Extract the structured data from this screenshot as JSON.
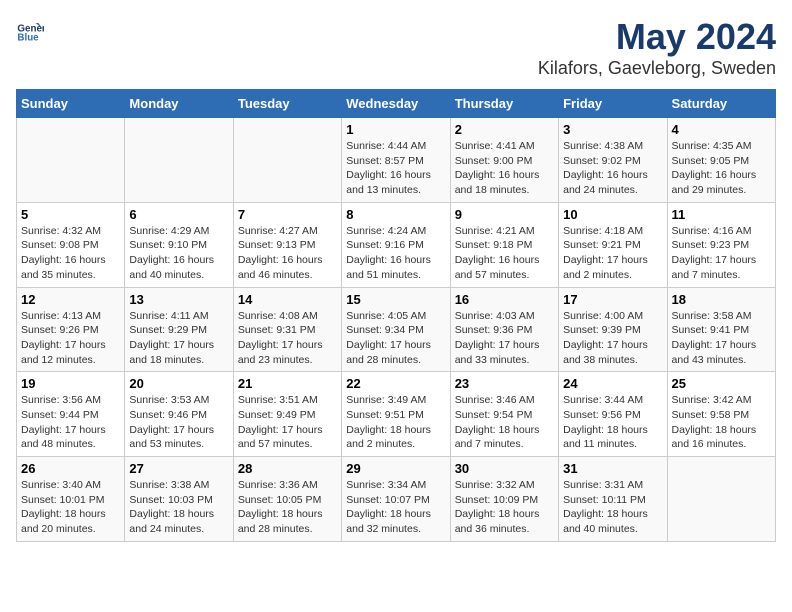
{
  "logo": {
    "text_general": "General",
    "text_blue": "Blue"
  },
  "title": "May 2024",
  "subtitle": "Kilafors, Gaevleborg, Sweden",
  "days_of_week": [
    "Sunday",
    "Monday",
    "Tuesday",
    "Wednesday",
    "Thursday",
    "Friday",
    "Saturday"
  ],
  "weeks": [
    [
      {
        "day": "",
        "info": ""
      },
      {
        "day": "",
        "info": ""
      },
      {
        "day": "",
        "info": ""
      },
      {
        "day": "1",
        "info": "Sunrise: 4:44 AM\nSunset: 8:57 PM\nDaylight: 16 hours\nand 13 minutes."
      },
      {
        "day": "2",
        "info": "Sunrise: 4:41 AM\nSunset: 9:00 PM\nDaylight: 16 hours\nand 18 minutes."
      },
      {
        "day": "3",
        "info": "Sunrise: 4:38 AM\nSunset: 9:02 PM\nDaylight: 16 hours\nand 24 minutes."
      },
      {
        "day": "4",
        "info": "Sunrise: 4:35 AM\nSunset: 9:05 PM\nDaylight: 16 hours\nand 29 minutes."
      }
    ],
    [
      {
        "day": "5",
        "info": "Sunrise: 4:32 AM\nSunset: 9:08 PM\nDaylight: 16 hours\nand 35 minutes."
      },
      {
        "day": "6",
        "info": "Sunrise: 4:29 AM\nSunset: 9:10 PM\nDaylight: 16 hours\nand 40 minutes."
      },
      {
        "day": "7",
        "info": "Sunrise: 4:27 AM\nSunset: 9:13 PM\nDaylight: 16 hours\nand 46 minutes."
      },
      {
        "day": "8",
        "info": "Sunrise: 4:24 AM\nSunset: 9:16 PM\nDaylight: 16 hours\nand 51 minutes."
      },
      {
        "day": "9",
        "info": "Sunrise: 4:21 AM\nSunset: 9:18 PM\nDaylight: 16 hours\nand 57 minutes."
      },
      {
        "day": "10",
        "info": "Sunrise: 4:18 AM\nSunset: 9:21 PM\nDaylight: 17 hours\nand 2 minutes."
      },
      {
        "day": "11",
        "info": "Sunrise: 4:16 AM\nSunset: 9:23 PM\nDaylight: 17 hours\nand 7 minutes."
      }
    ],
    [
      {
        "day": "12",
        "info": "Sunrise: 4:13 AM\nSunset: 9:26 PM\nDaylight: 17 hours\nand 12 minutes."
      },
      {
        "day": "13",
        "info": "Sunrise: 4:11 AM\nSunset: 9:29 PM\nDaylight: 17 hours\nand 18 minutes."
      },
      {
        "day": "14",
        "info": "Sunrise: 4:08 AM\nSunset: 9:31 PM\nDaylight: 17 hours\nand 23 minutes."
      },
      {
        "day": "15",
        "info": "Sunrise: 4:05 AM\nSunset: 9:34 PM\nDaylight: 17 hours\nand 28 minutes."
      },
      {
        "day": "16",
        "info": "Sunrise: 4:03 AM\nSunset: 9:36 PM\nDaylight: 17 hours\nand 33 minutes."
      },
      {
        "day": "17",
        "info": "Sunrise: 4:00 AM\nSunset: 9:39 PM\nDaylight: 17 hours\nand 38 minutes."
      },
      {
        "day": "18",
        "info": "Sunrise: 3:58 AM\nSunset: 9:41 PM\nDaylight: 17 hours\nand 43 minutes."
      }
    ],
    [
      {
        "day": "19",
        "info": "Sunrise: 3:56 AM\nSunset: 9:44 PM\nDaylight: 17 hours\nand 48 minutes."
      },
      {
        "day": "20",
        "info": "Sunrise: 3:53 AM\nSunset: 9:46 PM\nDaylight: 17 hours\nand 53 minutes."
      },
      {
        "day": "21",
        "info": "Sunrise: 3:51 AM\nSunset: 9:49 PM\nDaylight: 17 hours\nand 57 minutes."
      },
      {
        "day": "22",
        "info": "Sunrise: 3:49 AM\nSunset: 9:51 PM\nDaylight: 18 hours\nand 2 minutes."
      },
      {
        "day": "23",
        "info": "Sunrise: 3:46 AM\nSunset: 9:54 PM\nDaylight: 18 hours\nand 7 minutes."
      },
      {
        "day": "24",
        "info": "Sunrise: 3:44 AM\nSunset: 9:56 PM\nDaylight: 18 hours\nand 11 minutes."
      },
      {
        "day": "25",
        "info": "Sunrise: 3:42 AM\nSunset: 9:58 PM\nDaylight: 18 hours\nand 16 minutes."
      }
    ],
    [
      {
        "day": "26",
        "info": "Sunrise: 3:40 AM\nSunset: 10:01 PM\nDaylight: 18 hours\nand 20 minutes."
      },
      {
        "day": "27",
        "info": "Sunrise: 3:38 AM\nSunset: 10:03 PM\nDaylight: 18 hours\nand 24 minutes."
      },
      {
        "day": "28",
        "info": "Sunrise: 3:36 AM\nSunset: 10:05 PM\nDaylight: 18 hours\nand 28 minutes."
      },
      {
        "day": "29",
        "info": "Sunrise: 3:34 AM\nSunset: 10:07 PM\nDaylight: 18 hours\nand 32 minutes."
      },
      {
        "day": "30",
        "info": "Sunrise: 3:32 AM\nSunset: 10:09 PM\nDaylight: 18 hours\nand 36 minutes."
      },
      {
        "day": "31",
        "info": "Sunrise: 3:31 AM\nSunset: 10:11 PM\nDaylight: 18 hours\nand 40 minutes."
      },
      {
        "day": "",
        "info": ""
      }
    ]
  ]
}
